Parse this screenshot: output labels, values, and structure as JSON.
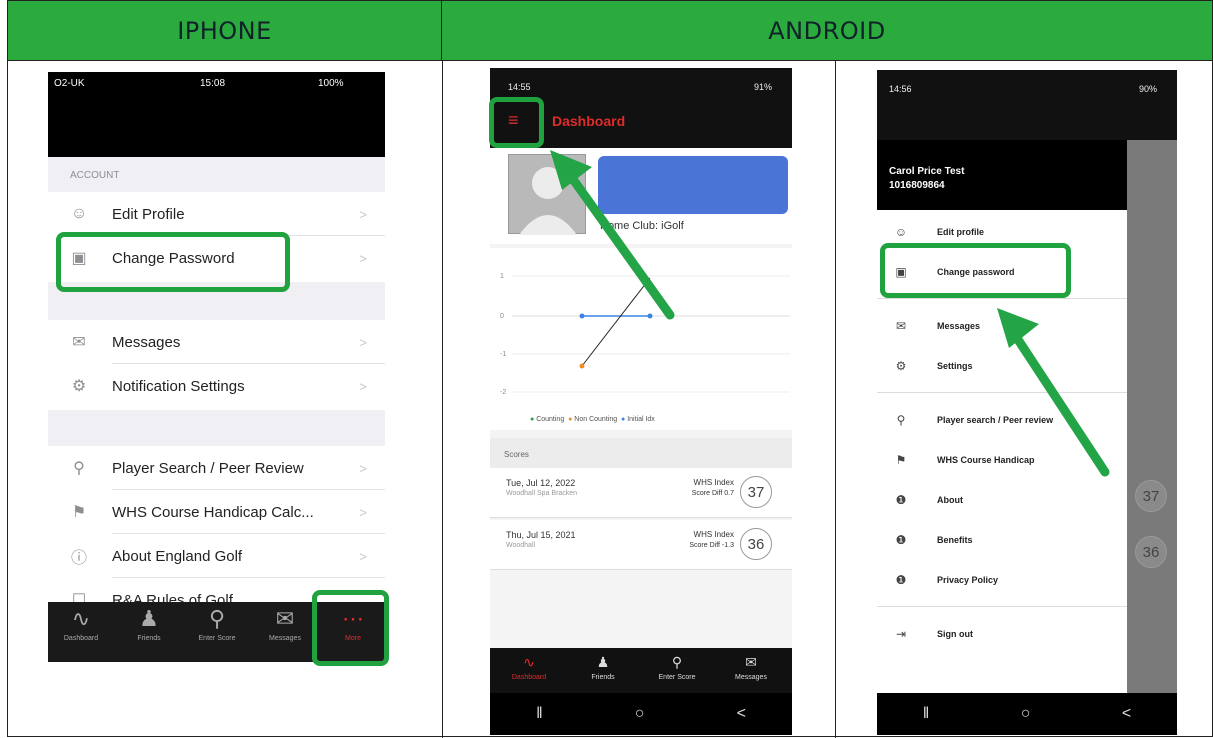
{
  "header": {
    "iphone": "IPHONE",
    "android": "ANDROID"
  },
  "iphone": {
    "status": {
      "carrier": "O2-UK",
      "time": "15:08",
      "battery": "100%"
    },
    "section_account": "ACCOUNT",
    "rows": [
      {
        "label": "Edit Profile",
        "icon": "person-icon"
      },
      {
        "label": "Change Password",
        "icon": "lock-icon"
      },
      {
        "label": "Messages",
        "icon": "envelope-icon"
      },
      {
        "label": "Notification Settings",
        "icon": "gear-icon"
      },
      {
        "label": "Player Search / Peer Review",
        "icon": "search-icon"
      },
      {
        "label": "WHS Course Handicap Calc...",
        "icon": "flag-icon"
      },
      {
        "label": "About England Golf",
        "icon": "info-icon"
      },
      {
        "label": "R&A Rules of Golf",
        "icon": "book-icon"
      }
    ],
    "tabs": [
      "Dashboard",
      "Friends",
      "Enter Score",
      "Messages",
      "More"
    ],
    "accent": "#20a23f"
  },
  "android1": {
    "status_time": "14:55",
    "status_right": "91%",
    "title": "Dashboard",
    "home_club": "Home Club: iGolf",
    "chart_y_ticks": [
      "1",
      "0",
      "-1",
      "-2"
    ],
    "legend": [
      "Counting",
      "Non Counting",
      "Initial Idx"
    ],
    "scores_header": "Scores",
    "scores": [
      {
        "date": "Tue, Jul 12, 2022",
        "course": "Woodhall Spa Bracken",
        "whs": "WHS Index",
        "diff": "Score Diff 0.7",
        "score": "37"
      },
      {
        "date": "Thu, Jul 15, 2021",
        "course": "Woodhall",
        "whs": "WHS Index",
        "diff": "Score Diff -1.3",
        "score": "36"
      }
    ],
    "tabs": [
      "Dashboard",
      "Friends",
      "Enter Score",
      "Messages"
    ],
    "title_color": "#e02b2b"
  },
  "android2": {
    "status_time": "14:56",
    "status_right": "90%",
    "user_name": "Carol Price Test",
    "user_id": "1016809864",
    "menu": [
      {
        "label": "Edit profile",
        "icon": "person-icon"
      },
      {
        "label": "Change password",
        "icon": "lock-icon"
      },
      {
        "label": "Messages",
        "icon": "envelope-icon"
      },
      {
        "label": "Settings",
        "icon": "gear-icon"
      },
      {
        "label": "Player search / Peer review",
        "icon": "search-icon"
      },
      {
        "label": "WHS Course Handicap",
        "icon": "flag-icon"
      },
      {
        "label": "About",
        "icon": "info-icon"
      },
      {
        "label": "Benefits",
        "icon": "info-icon"
      },
      {
        "label": "Privacy Policy",
        "icon": "info-icon"
      },
      {
        "label": "Sign out",
        "icon": "sign-out-icon"
      }
    ],
    "side_scores": [
      "37",
      "36"
    ]
  }
}
